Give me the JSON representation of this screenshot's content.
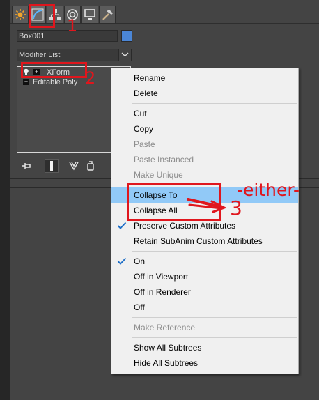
{
  "panel": {
    "object_name": "Box001",
    "object_color": "#4b86d6",
    "modifier_list_label": "Modifier List",
    "stack": [
      {
        "label": "XForm",
        "icons": [
          "lightbulb-icon",
          "expand-plus-icon"
        ]
      },
      {
        "label": "Editable Poly",
        "icons": [
          "expand-plus-icon"
        ]
      }
    ],
    "command_tabs": [
      "create-tab-sun-icon",
      "modify-tab-icon",
      "hierarchy-tab-icon",
      "motion-tab-icon",
      "display-tab-icon",
      "utilities-tab-hammer-icon"
    ],
    "stack_tools": [
      "pin-stack-icon",
      "show-end-result-icon",
      "make-unique-icon",
      "remove-modifier-icon",
      "configure-modifier-sets-icon"
    ]
  },
  "context_menu": {
    "highlight_color": "#91c9f7",
    "items": [
      {
        "label": "Rename",
        "enabled": true
      },
      {
        "label": "Delete",
        "enabled": true
      },
      {
        "separator": true
      },
      {
        "label": "Cut",
        "enabled": true
      },
      {
        "label": "Copy",
        "enabled": true
      },
      {
        "label": "Paste",
        "enabled": false
      },
      {
        "label": "Paste Instanced",
        "enabled": false
      },
      {
        "label": "Make Unique",
        "enabled": false
      },
      {
        "separator": true
      },
      {
        "label": "Collapse To",
        "enabled": true,
        "highlighted": true
      },
      {
        "label": "Collapse All",
        "enabled": true
      },
      {
        "label": "Preserve Custom Attributes",
        "enabled": true,
        "checked": true
      },
      {
        "label": "Retain SubAnim Custom Attributes",
        "enabled": true
      },
      {
        "separator": true
      },
      {
        "label": "On",
        "enabled": true,
        "checked": true
      },
      {
        "label": "Off in Viewport",
        "enabled": true
      },
      {
        "label": "Off in Renderer",
        "enabled": true
      },
      {
        "label": "Off",
        "enabled": true
      },
      {
        "separator": true
      },
      {
        "label": "Make Reference",
        "enabled": false
      },
      {
        "separator": true
      },
      {
        "label": "Show All Subtrees",
        "enabled": true
      },
      {
        "label": "Hide All Subtrees",
        "enabled": true
      }
    ]
  },
  "annotations": {
    "color": "#e0161d",
    "step1": "1",
    "step2": "2",
    "step3": "3",
    "either": "-either-"
  }
}
